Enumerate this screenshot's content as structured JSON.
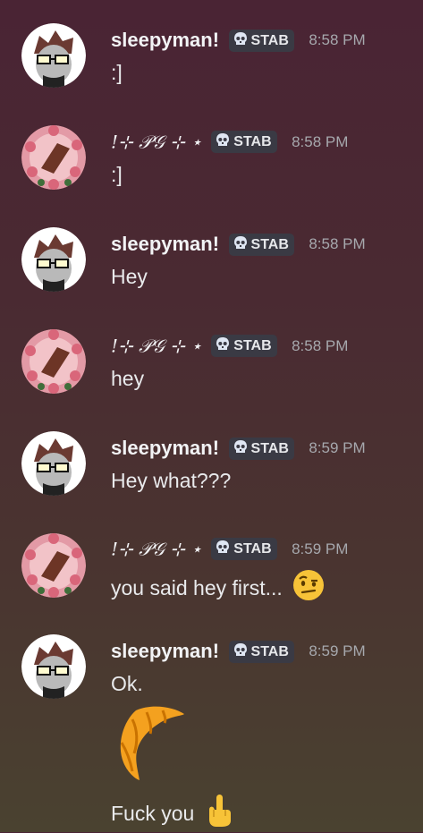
{
  "messages": [
    {
      "author": "sleepyman!",
      "tag": "STAB",
      "time": "8:58 PM",
      "lines": [
        ":]"
      ]
    },
    {
      "author": "!⊹ 𝒫𝒢 ⊹ ⋆",
      "tag": "STAB",
      "time": "8:58 PM",
      "lines": [
        ":]"
      ]
    },
    {
      "author": "sleepyman!",
      "tag": "STAB",
      "time": "8:58 PM",
      "lines": [
        "Hey"
      ]
    },
    {
      "author": "!⊹ 𝒫𝒢 ⊹ ⋆",
      "tag": "STAB",
      "time": "8:58 PM",
      "lines": [
        "hey"
      ]
    },
    {
      "author": "sleepyman!",
      "tag": "STAB",
      "time": "8:59 PM",
      "lines": [
        "Hey what???"
      ]
    },
    {
      "author": "!⊹ 𝒫𝒢 ⊹ ⋆",
      "tag": "STAB",
      "time": "8:59 PM",
      "lines": [
        "you said hey first..."
      ]
    },
    {
      "author": "sleepyman!",
      "tag": "STAB",
      "time": "8:59 PM",
      "lines": [
        "Ok.",
        "Fuck you"
      ]
    }
  ],
  "icons": {
    "tag_icon": "skull-icon",
    "emoji_raised_eyebrow": "face-with-raised-eyebrow-emoji",
    "emoji_croissant": "croissant-emoji",
    "emoji_middle_finger": "middle-finger-emoji"
  }
}
